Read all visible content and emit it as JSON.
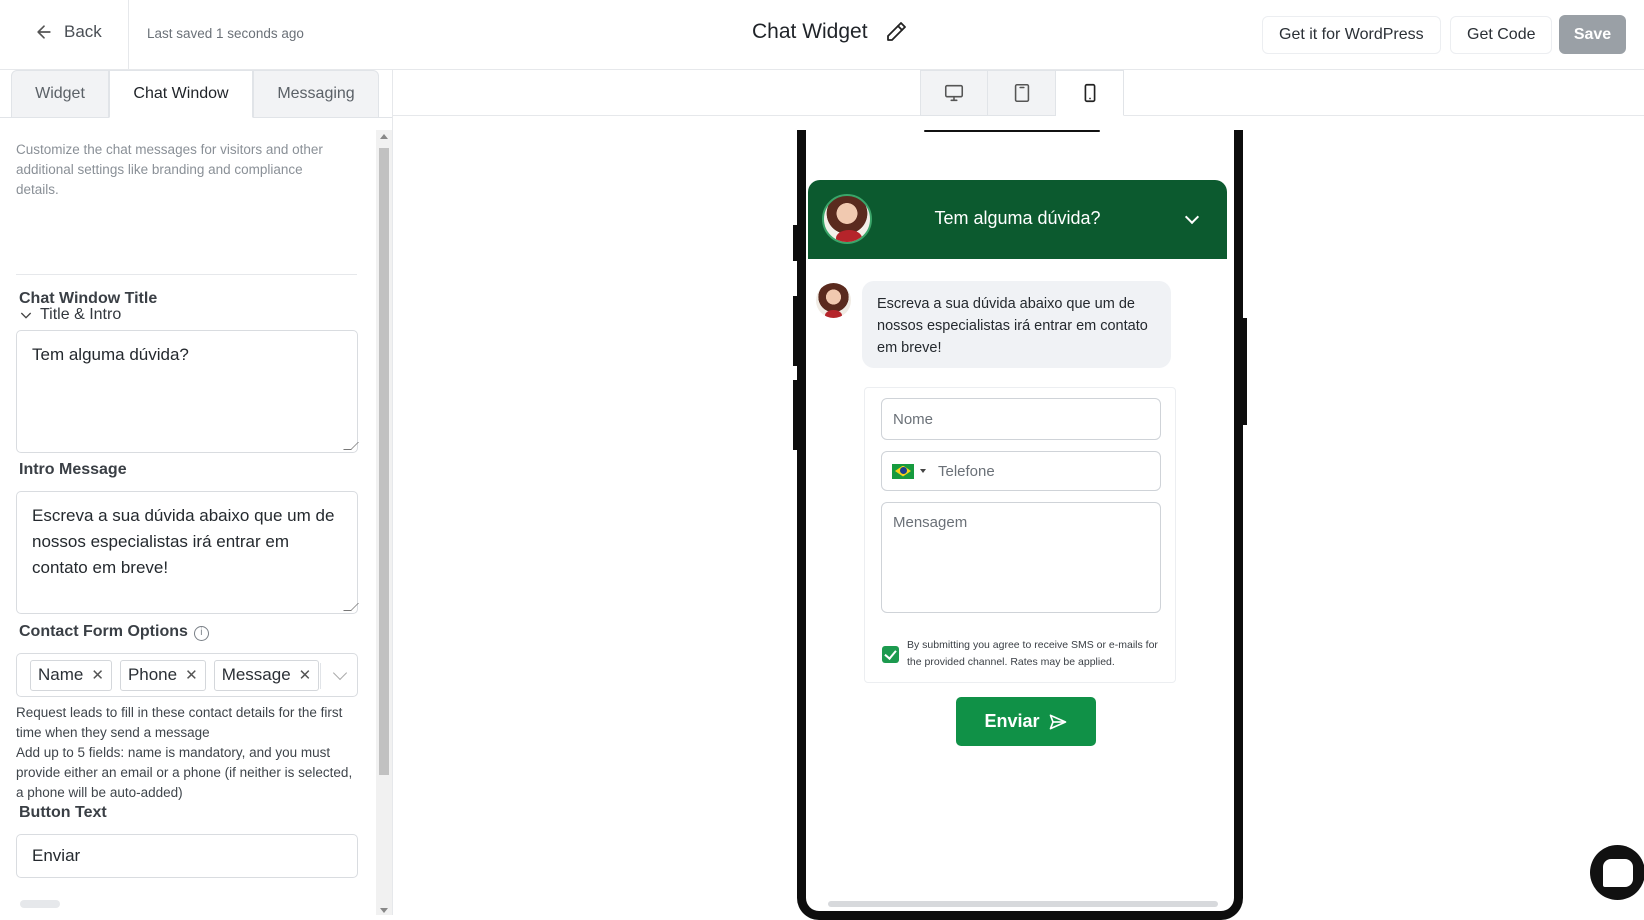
{
  "header": {
    "back_label": "Back",
    "last_saved": "Last saved 1 seconds ago",
    "title": "Chat Widget",
    "wordpress_button": "Get it for WordPress",
    "get_code_button": "Get Code",
    "save_button": "Save"
  },
  "tabs": [
    {
      "label": "Widget"
    },
    {
      "label": "Chat Window",
      "active": true
    },
    {
      "label": "Messaging"
    }
  ],
  "panel": {
    "description": "Customize the chat messages for visitors and other additional settings like branding and compliance details.",
    "section_title": "Title & Intro",
    "chat_window_title_label": "Chat Window Title",
    "chat_window_title_value": "Tem alguma dúvida?",
    "intro_message_label": "Intro Message",
    "intro_message_value": "Escreva a sua dúvida abaixo que um de nossos especialistas irá entrar em contato em breve!",
    "contact_form_label": "Contact Form Options",
    "contact_form_tags": [
      "Name",
      "Phone",
      "Message"
    ],
    "contact_help_1": "Request leads to fill in these contact details for the first time when they send a message",
    "contact_help_2": "Add up to 5 fields: name is mandatory, and you must provide either an email or a phone (if neither is selected, a phone will be auto-added)",
    "button_text_label": "Button Text",
    "button_text_value": "Enviar"
  },
  "devices": [
    {
      "name": "desktop",
      "icon": "monitor-icon"
    },
    {
      "name": "tablet",
      "icon": "tablet-icon"
    },
    {
      "name": "mobile",
      "icon": "smartphone-icon",
      "active": true
    }
  ],
  "preview": {
    "header_title": "Tem alguma dúvida?",
    "intro_bubble": "Escreva a sua dúvida abaixo que um de nossos especialistas irá entrar em contato em breve!",
    "name_placeholder": "Nome",
    "phone_placeholder": "Telefone",
    "message_placeholder": "Mensagem",
    "consent_text": "By submitting you agree to receive SMS or e-mails for the provided channel. Rates may be applied.",
    "consent_checked": true,
    "send_button": "Enviar",
    "header_color": "#0c5a2f",
    "button_color": "#109147"
  }
}
